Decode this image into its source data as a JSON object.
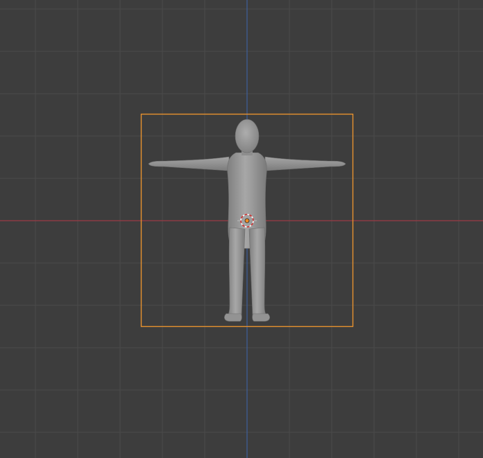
{
  "viewport": {
    "view": "front-orthographic",
    "shading": "solid",
    "object_mode": "object",
    "colors": {
      "background": "#3d3d3d",
      "grid_line": "#4a4a4a",
      "axis_x": "#9b3b45",
      "axis_z": "#3e5f9c",
      "selection_outline": "#e8922e",
      "mesh_fill": "#9a9a9a",
      "origin": "#f08a24"
    }
  },
  "scene": {
    "selected_object": {
      "type": "mesh",
      "shape": "human-figure-t-pose",
      "selected": true,
      "active": true
    },
    "cursor_3d": {
      "visible": true
    }
  }
}
